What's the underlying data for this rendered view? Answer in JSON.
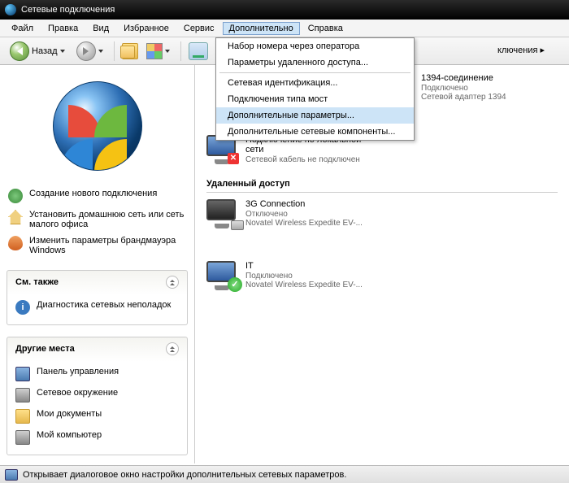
{
  "title": "Сетевые подключения",
  "menu": {
    "file": "Файл",
    "edit": "Правка",
    "view": "Вид",
    "favorites": "Избранное",
    "service": "Сервис",
    "advanced": "Дополнительно",
    "help": "Справка"
  },
  "toolbar": {
    "back": "Назад",
    "address_suffix": "ключения"
  },
  "dropdown": {
    "i0": "Набор номера через оператора",
    "i1": "Параметры удаленного доступа...",
    "i2": "Сетевая идентификация...",
    "i3": "Подключения типа мост",
    "i4": "Дополнительные параметры...",
    "i5": "Дополнительные сетевые компоненты..."
  },
  "tasks": {
    "t0": "Создание нового подключения",
    "t1": "Установить домашнюю сеть или сеть малого офиса",
    "t2": "Изменить параметры брандмауэра Windows"
  },
  "see_also": {
    "title": "См. также",
    "i0": "Диагностика сетевых неполадок"
  },
  "other_places": {
    "title": "Другие места",
    "i0": "Панель управления",
    "i1": "Сетевое окружение",
    "i2": "Мои документы",
    "i3": "Мой компьютер"
  },
  "groups": {
    "remote": "Удаленный доступ"
  },
  "conn": {
    "c1394": {
      "name": "1394-соединение",
      "state": "Подключено",
      "device": "Сетевой адаптер 1394"
    },
    "lan": {
      "name": "Подключение по локальной сети",
      "state": "Сетевой кабель не подключен"
    },
    "c3g": {
      "name": "3G Connection",
      "state": "Отключено",
      "device": "Novatel Wireless Expedite EV-..."
    },
    "it": {
      "name": "IT",
      "state": "Подключено",
      "device": "Novatel Wireless Expedite EV-..."
    }
  },
  "status": "Открывает диалоговое окно настройки дополнительных сетевых параметров."
}
